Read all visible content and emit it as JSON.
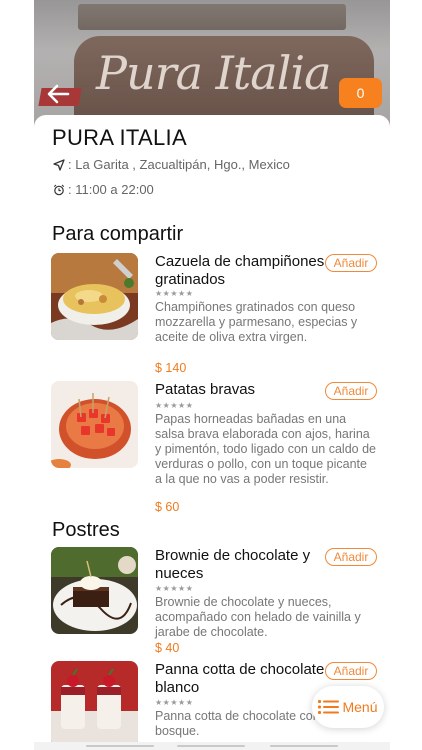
{
  "header": {
    "cart_count": "0",
    "hero_sign_text": "Pura Italia"
  },
  "restaurant": {
    "name": "PURA ITALIA",
    "address": ": La Garita , Zacualtipán, Hgo., Mexico",
    "hours": ": 11:00 a 22:00"
  },
  "sections": [
    {
      "title": "Para compartir",
      "items": [
        {
          "name": "Cazuela de champiñones gratinados",
          "add_label": "Añadir",
          "rating": "★★★★★",
          "description": "Champiñones gratinados con queso mozzarella y parmesano, especias y aceite de oliva extra virgen.",
          "price": "$ 140"
        },
        {
          "name": "Patatas bravas",
          "add_label": "Añadir",
          "rating": "★★★★★",
          "description": "Papas horneadas bañadas en una salsa brava elaborada con ajos, harina y pimentón, todo ligado con un caldo de verduras o pollo, con un toque picante a la que no vas a poder resistir.",
          "price": "$ 60"
        }
      ]
    },
    {
      "title": "Postres",
      "items": [
        {
          "name": "Brownie de chocolate y nueces",
          "add_label": "Añadir",
          "rating": "★★★★★",
          "description": "Brownie de chocolate y nueces, acompañado con helado de vainilla y jarabe de chocolate.",
          "price": "$ 40"
        },
        {
          "name": "Panna cotta de chocolate blanco",
          "add_label": "Añadir",
          "rating": "★★★★★",
          "description": "Panna cotta de chocolate con frutos del bosque."
        }
      ]
    }
  ],
  "menu_button": {
    "label": "Menú"
  },
  "colors": {
    "accent": "#f7801f",
    "price": "#f07b1d"
  }
}
